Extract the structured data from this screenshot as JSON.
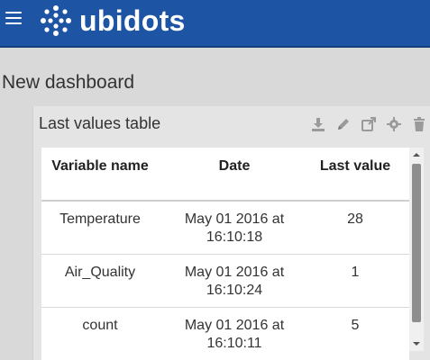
{
  "header": {
    "brand": "ubidots",
    "brand_color": "#1d55a4"
  },
  "page": {
    "title": "New dashboard"
  },
  "widget": {
    "title": "Last values table",
    "tools": [
      "download-icon",
      "pencil-icon",
      "share-icon",
      "gear-icon",
      "trash-icon"
    ],
    "columns": [
      "Variable name",
      "Date",
      "Last value"
    ],
    "rows": [
      {
        "variable": "Temperature",
        "date": "May 01 2016 at 16:10:18",
        "value": "28"
      },
      {
        "variable": "Air_Quality",
        "date": "May 01 2016 at 16:10:24",
        "value": "1"
      },
      {
        "variable": "count",
        "date": "May 01 2016 at 16:10:11",
        "value": "5"
      }
    ]
  }
}
